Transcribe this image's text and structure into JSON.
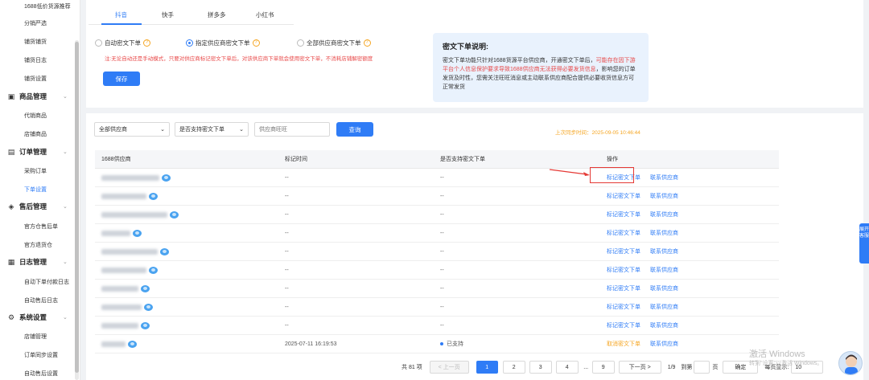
{
  "sidebar": {
    "top_items": [
      "1688低价货源推荐",
      "分销严选",
      "铺货铺货",
      "铺货日志",
      "铺货设置"
    ],
    "groups": [
      {
        "label": "商品管理",
        "icon": "box-icon",
        "items": [
          "代销商品",
          "店铺商品"
        ]
      },
      {
        "label": "订单管理",
        "icon": "order-icon",
        "items": [
          "采购订单",
          "下单设置"
        ]
      },
      {
        "label": "售后管理",
        "icon": "aftersale-icon",
        "items": [
          "官方仓售后单",
          "官方退货仓"
        ]
      },
      {
        "label": "日志管理",
        "icon": "log-icon",
        "items": [
          "自动下单付款日志",
          "自动售后日志"
        ]
      },
      {
        "label": "系统设置",
        "icon": "settings-icon",
        "items": [
          "店铺管理",
          "订单同步设置",
          "自动售后设置"
        ]
      }
    ],
    "active_item": "下单设置"
  },
  "tabs": [
    "抖音",
    "快手",
    "拼多多",
    "小红书"
  ],
  "options": {
    "radio1": "自动密文下单",
    "radio2": "指定供应商密文下单",
    "radio3": "全部供应商密文下单",
    "note": "注:无论自动还是手动模式，只要对供应商标记密文下单后，对该供应商下单就会使用密文下单，不消耗店铺解密额度",
    "save_label": "保存"
  },
  "explain": {
    "title": "密文下单说明:",
    "text1": "密文下单功能只针对1688货源平台供应商，开通密文下单后，",
    "text_red": "可能存在因下游平台个人信息保护要求导致1688供应商无法获得必要发货信息",
    "text2": "，影响您的订单发货及时性，您需关注旺旺消息或主动联系供应商配合提供必要收货信息方可正常发货"
  },
  "filters": {
    "supplier_select": "全部供应商",
    "support_select": "是否支持密文下单",
    "supplier_placeholder": "供应商旺旺",
    "query_label": "查询",
    "sync_time": "上次同步时间：2025-09-05 10:46:44"
  },
  "table": {
    "headers": [
      "1688供应商",
      "标记时间",
      "是否支持密文下单",
      "操作"
    ],
    "rows": [
      {
        "time": "--",
        "support": "--",
        "op1": "标记密文下单",
        "op2": "联系供应商"
      },
      {
        "time": "--",
        "support": "--",
        "op1": "标记密文下单",
        "op2": "联系供应商"
      },
      {
        "time": "--",
        "support": "--",
        "op1": "标记密文下单",
        "op2": "联系供应商"
      },
      {
        "time": "--",
        "support": "--",
        "op1": "标记密文下单",
        "op2": "联系供应商"
      },
      {
        "time": "--",
        "support": "--",
        "op1": "标记密文下单",
        "op2": "联系供应商"
      },
      {
        "time": "--",
        "support": "--",
        "op1": "标记密文下单",
        "op2": "联系供应商"
      },
      {
        "time": "--",
        "support": "--",
        "op1": "标记密文下单",
        "op2": "联系供应商"
      },
      {
        "time": "--",
        "support": "--",
        "op1": "标记密文下单",
        "op2": "联系供应商"
      },
      {
        "time": "--",
        "support": "--",
        "op1": "标记密文下单",
        "op2": "联系供应商"
      },
      {
        "time": "2025-07-11 16:19:53",
        "support": "已支持",
        "op1": "取消密文下单",
        "op2": "联系供应商"
      }
    ]
  },
  "pager": {
    "total": "共 81 项",
    "prev": "< 上一页",
    "pages": [
      "1",
      "2",
      "3",
      "4",
      "...",
      "9"
    ],
    "next": "下一页 >",
    "page_info": "1/9",
    "goto": "到第",
    "page_unit": "页",
    "confirm": "确定",
    "per_page_label": "每页显示:",
    "per_page": "10"
  },
  "float_tab": "展开客服",
  "watermark": "激活 Windows",
  "watermark2": "转到\"设置\"以激活 Windows。",
  "colors": {
    "accent": "#2f7cf6",
    "warning": "#f5a623",
    "danger": "#e84a4a"
  }
}
